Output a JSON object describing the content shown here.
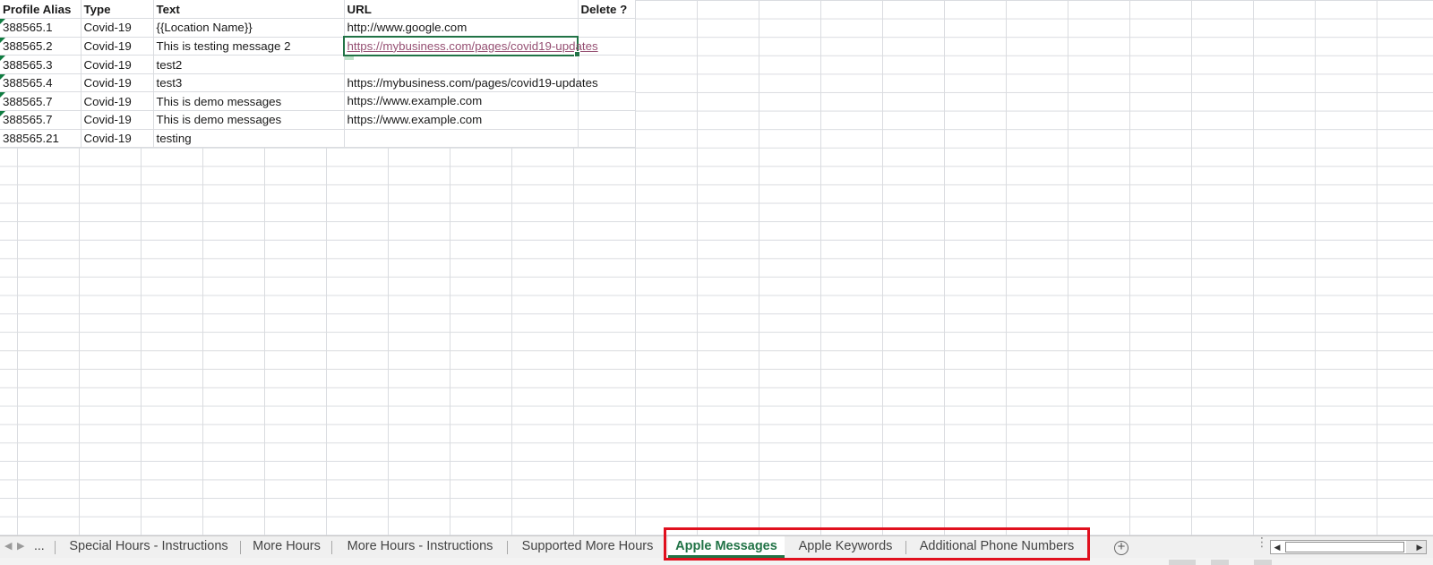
{
  "sheet": {
    "headers": [
      "Profile Alias",
      "Type",
      "Text",
      "URL",
      "Delete ?"
    ],
    "rows": [
      {
        "alias": "388565.1",
        "type": "Covid-19",
        "text": "{{Location Name}}",
        "url": "http://www.google.com",
        "delete": ""
      },
      {
        "alias": "388565.2",
        "type": "Covid-19",
        "text": "This is testing message 2",
        "url": "https://mybusiness.com/pages/covid19-updates",
        "delete": ""
      },
      {
        "alias": "388565.3",
        "type": "Covid-19",
        "text": "test2",
        "url": "",
        "delete": ""
      },
      {
        "alias": "388565.4",
        "type": "Covid-19",
        "text": "test3",
        "url": "https://mybusiness.com/pages/covid19-updates",
        "delete": ""
      },
      {
        "alias": "388565.7",
        "type": "Covid-19",
        "text": "This is demo messages",
        "url": "https://www.example.com",
        "delete": ""
      },
      {
        "alias": "388565.7",
        "type": "Covid-19",
        "text": "This is demo messages",
        "url": "https://www.example.com",
        "delete": ""
      },
      {
        "alias": "388565.21",
        "type": "Covid-19",
        "text": "testing",
        "url": "",
        "delete": ""
      }
    ]
  },
  "tabs": {
    "nav_left": "◀",
    "nav_right": "▶",
    "ellipsis": "...",
    "items": [
      {
        "label": "Special Hours - Instructions",
        "active": false
      },
      {
        "label": "More Hours",
        "active": false
      },
      {
        "label": "More Hours - Instructions",
        "active": false
      },
      {
        "label": "Supported More Hours",
        "active": false
      },
      {
        "label": "Apple Messages",
        "active": true
      },
      {
        "label": "Apple Keywords",
        "active": false
      },
      {
        "label": "Additional Phone Numbers",
        "active": false
      }
    ],
    "add_symbol": "+",
    "kebab": "⋮",
    "scroll_left": "◀",
    "scroll_right": "▶"
  },
  "colors": {
    "accent": "#217346",
    "highlight_box": "#e0101e",
    "link": "#954f72"
  }
}
